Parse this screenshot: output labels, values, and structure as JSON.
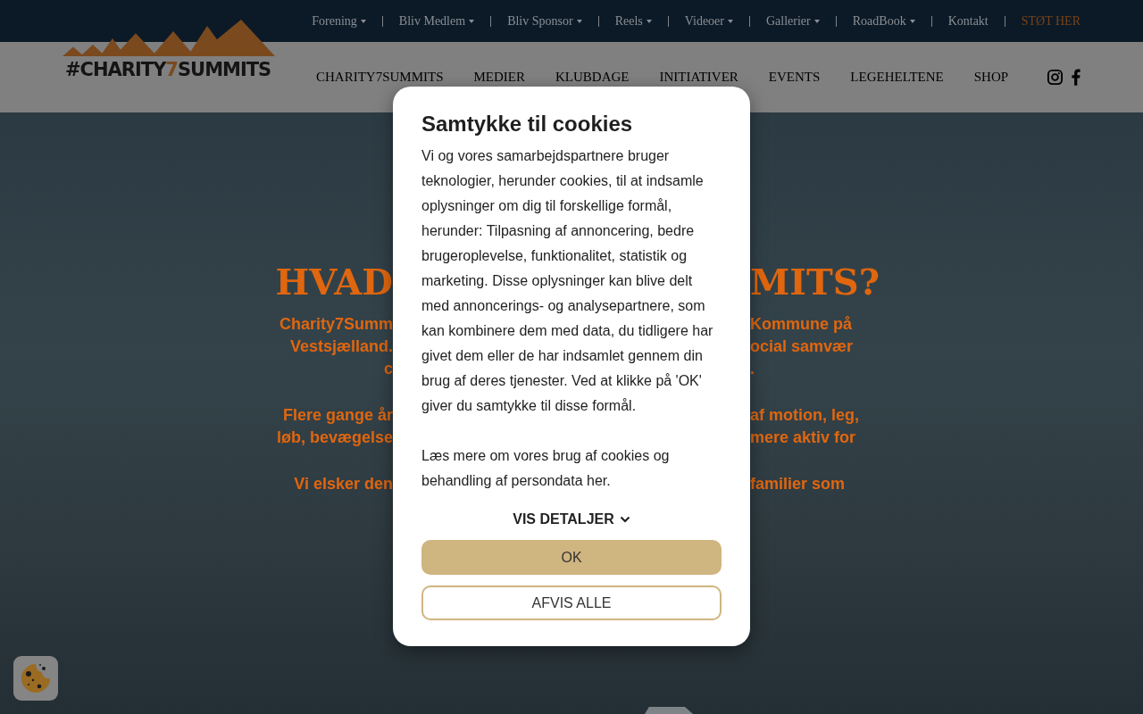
{
  "top_menu": [
    {
      "label": "Forening",
      "dropdown": true,
      "highlighted": false
    },
    {
      "label": "Bliv Medlem",
      "dropdown": true,
      "highlighted": false
    },
    {
      "label": "Bliv Sponsor",
      "dropdown": true,
      "highlighted": false
    },
    {
      "label": "Reels",
      "dropdown": true,
      "highlighted": false
    },
    {
      "label": "Videoer",
      "dropdown": true,
      "highlighted": false
    },
    {
      "label": "Gallerier",
      "dropdown": true,
      "highlighted": false
    },
    {
      "label": "RoadBook",
      "dropdown": true,
      "highlighted": false
    },
    {
      "label": "Kontakt",
      "dropdown": false,
      "highlighted": false
    },
    {
      "label": "STØT HER",
      "dropdown": false,
      "highlighted": true
    }
  ],
  "logo": {
    "before": "#CHARITY",
    "accent": "7",
    "after": "SUMMITS"
  },
  "main_nav": [
    "CHARITY7SUMMITS",
    "MEDIER",
    "KLUBDAGE",
    "INITIATIVER",
    "EVENTS",
    "LEGEHELTENE",
    "SHOP"
  ],
  "hero": {
    "title": {
      "left": "HVAD",
      "right": "MITS?"
    },
    "paragraphs": [
      {
        "lines": [
          {
            "left": "Charity7Summ",
            "right": "Kommune på"
          },
          {
            "left": "Vestsjælland.",
            "right": "ocial samvær"
          },
          {
            "left": "c",
            "right": "."
          }
        ]
      },
      {
        "lines": [
          {
            "left": "Flere gange år",
            "right": "af motion, leg,"
          },
          {
            "left": "løb, bevægelse",
            "right": "mere aktiv for"
          }
        ]
      },
      {
        "lines": [
          {
            "left": "Vi elsker den",
            "right": "familier som"
          }
        ]
      }
    ]
  },
  "cookie_dialog": {
    "title": "Samtykke til cookies",
    "paragraphs": [
      "Vi og vores samarbejdspartnere bruger teknologier, herunder cookies, til at indsamle oplysninger om dig til forskellige formål, herunder: Tilpasning af annoncering, bedre brugeroplevelse, funktionalitet, statistik og marketing. Disse oplysninger kan blive delt med annoncerings- og analysepartnere, som kan kombinere dem med data, du tidligere har givet dem eller de har indsamlet gennem din brug af deres tjenester. Ved at klikke på 'OK' giver du samtykke til disse formål.",
      "Læs mere om vores brug af cookies og behandling af persondata her."
    ],
    "details": "VIS DETALJER",
    "buttons": [
      {
        "label": "OK",
        "kind": "primary"
      },
      {
        "label": "AFVIS ALLE",
        "kind": "outline"
      }
    ]
  }
}
